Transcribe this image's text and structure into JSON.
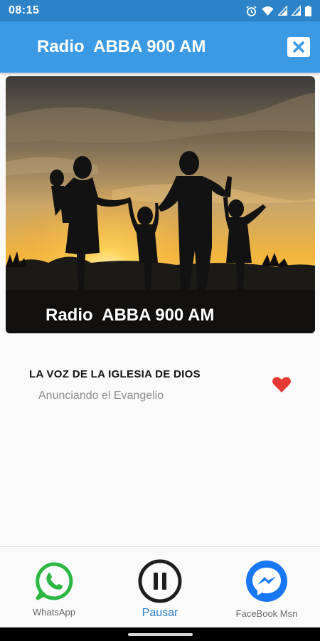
{
  "status_bar": {
    "time": "08:15",
    "icons": [
      "alarm-icon",
      "wifi-icon",
      "signal-icon",
      "signal-icon",
      "battery-icon"
    ]
  },
  "app_bar": {
    "title": "Radio  ABBA 900 AM",
    "close_icon": "close-icon"
  },
  "cover": {
    "image": "family-silhouette-sunset",
    "caption": "Radio  ABBA 900 AM"
  },
  "program": {
    "title": "LA VOZ DE LA IGLESIA DE DIOS",
    "subtitle": "Anunciando el Evangelio",
    "favorite_icon": "heart-icon"
  },
  "actions": {
    "whatsapp_label": "WhatsApp",
    "play_label": "Pausar",
    "messenger_label": "FaceBook Msn"
  },
  "colors": {
    "status_bar": "#2d83c8",
    "app_bar": "#3c9ae4",
    "heart": "#e53935",
    "whatsapp": "#2bb741",
    "messenger": "#1877f2",
    "accent_text": "#2d83c8"
  }
}
